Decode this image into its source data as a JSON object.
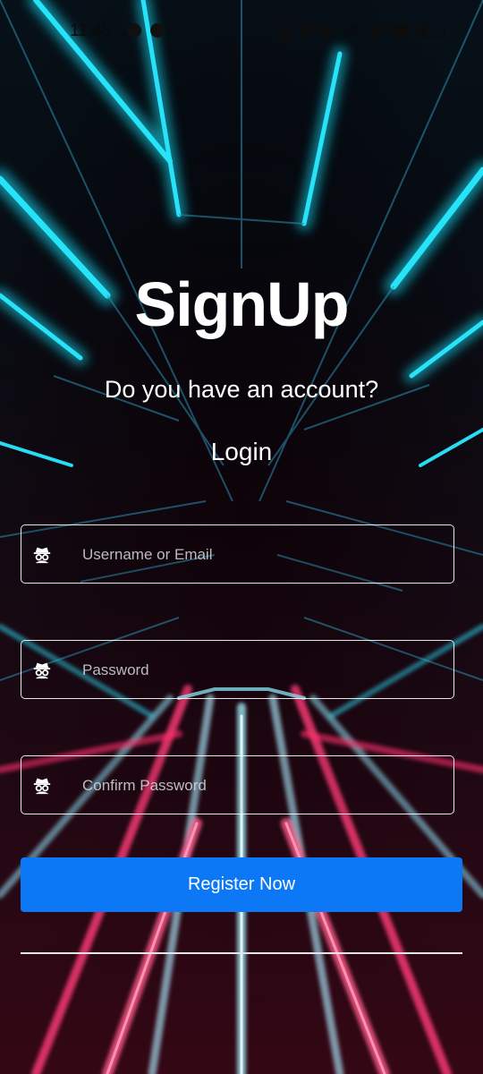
{
  "status_bar": {
    "time": "11:45",
    "network_speed": "0.00 KB/S",
    "icons": [
      "whatsapp-icon",
      "app-icon",
      "alarm-icon",
      "mute-icon",
      "bluetooth-icon",
      "data-icon",
      "signal-icon",
      "battery-icon"
    ]
  },
  "header": {
    "title": "SignUp",
    "question": "Do you have an account?",
    "login_label": "Login"
  },
  "form": {
    "username_placeholder": "Username or Email",
    "username_value": "",
    "password_placeholder": "Password",
    "password_value": "",
    "confirm_placeholder": "Confirm Password",
    "confirm_value": "",
    "field_icon": "incognito-icon",
    "register_label": "Register Now"
  },
  "colors": {
    "button": "#0d78f5",
    "cyan_glow": "#16e6ff",
    "pink_glow": "#ff2e6e"
  }
}
